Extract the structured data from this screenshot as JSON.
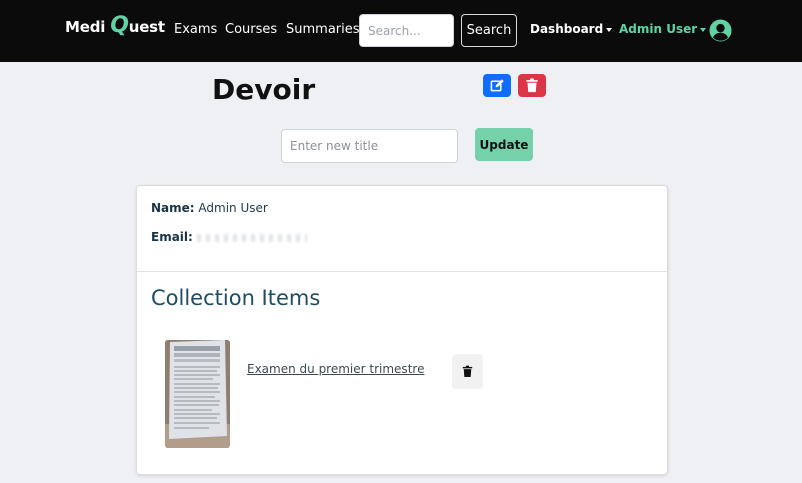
{
  "nav": {
    "brand_first": "Medi",
    "brand_q": "Q",
    "brand_rest": "uest",
    "links": [
      "Exams",
      "Courses",
      "Summaries"
    ],
    "search_placeholder": "Search...",
    "search_label": "Search",
    "dashboard_label": "Dashboard",
    "user_label": "Admin User",
    "accent_color": "#5fd3a3"
  },
  "collection": {
    "title": "Devoir",
    "new_title_placeholder": "Enter new title",
    "update_label": "Update",
    "edit_icon": "edit-icon",
    "delete_icon": "trash-icon"
  },
  "profile": {
    "name_label": "Name:",
    "name_value": "Admin User",
    "email_label": "Email:"
  },
  "items_section": {
    "title": "Collection Items",
    "items": [
      {
        "name": "Examen du premier trimestre"
      }
    ]
  }
}
